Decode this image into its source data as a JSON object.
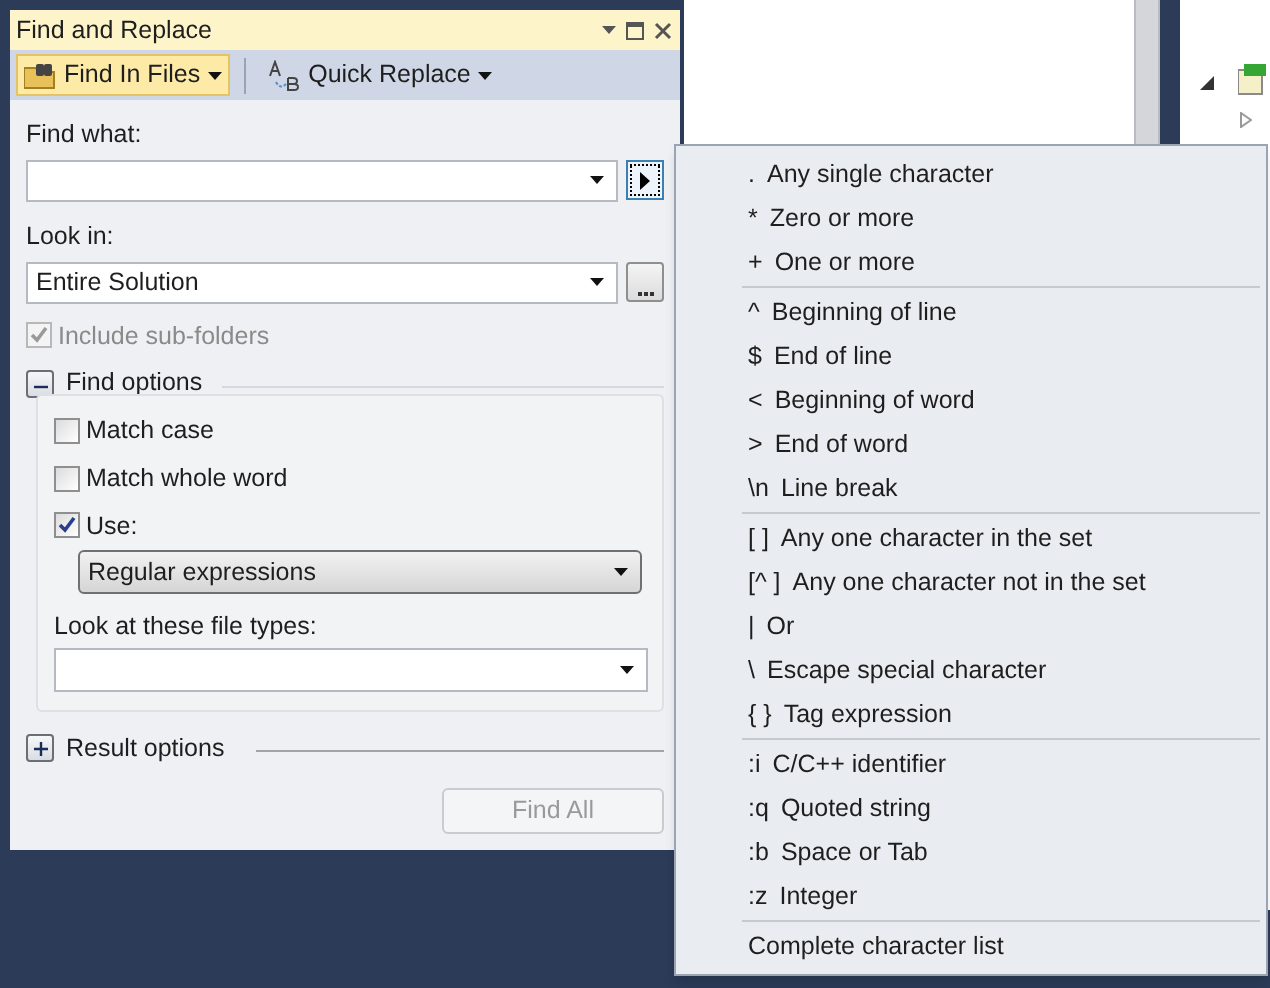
{
  "dialog": {
    "title": "Find and Replace",
    "toolbar": [
      {
        "label": "Find In Files",
        "selected": true
      },
      {
        "label": "Quick Replace",
        "selected": false
      }
    ],
    "find_what": {
      "label": "Find what:"
    },
    "look_in": {
      "label": "Look in:",
      "value": "Entire Solution"
    },
    "include_subfolders": {
      "label": "Include sub-folders",
      "checked": true,
      "disabled": true
    },
    "find_options": {
      "label": "Find options",
      "expanded": true,
      "options": [
        {
          "label": "Match case",
          "checked": false
        },
        {
          "label": "Match whole word",
          "checked": false
        },
        {
          "label": "Use:",
          "checked": true
        }
      ],
      "use_value": "Regular expressions",
      "file_types": {
        "label": "Look at these file types:"
      }
    },
    "result_options": {
      "label": "Result options",
      "expanded": false
    },
    "find_all": {
      "label": "Find All",
      "disabled": true
    }
  },
  "expression_menu": {
    "groups": [
      {
        "items": [
          {
            "symbol": ".",
            "label": "Any single character"
          },
          {
            "symbol": "*",
            "label": "Zero or more"
          },
          {
            "symbol": "+",
            "label": "One or more"
          }
        ]
      },
      {
        "items": [
          {
            "symbol": "^",
            "label": "Beginning of line"
          },
          {
            "symbol": "$",
            "label": "End of line"
          },
          {
            "symbol": "<",
            "label": "Beginning of word"
          },
          {
            "symbol": ">",
            "label": "End of word"
          },
          {
            "symbol": "\\n",
            "label": "Line break"
          }
        ]
      },
      {
        "items": [
          {
            "symbol": "[ ]",
            "label": "Any one character in the set"
          },
          {
            "symbol": "[^ ]",
            "label": "Any one character not in the set"
          },
          {
            "symbol": "|",
            "label": "Or"
          },
          {
            "symbol": "\\",
            "label": "Escape special character"
          },
          {
            "symbol": "{ }",
            "label": "Tag expression"
          }
        ]
      },
      {
        "items": [
          {
            "symbol": ":i",
            "label": "C/C++ identifier"
          },
          {
            "symbol": ":q",
            "label": "Quoted string"
          },
          {
            "symbol": ":b",
            "label": "Space or Tab"
          },
          {
            "symbol": ":z",
            "label": "Integer"
          }
        ]
      },
      {
        "items": [
          {
            "label": "Complete character list"
          }
        ]
      }
    ]
  }
}
